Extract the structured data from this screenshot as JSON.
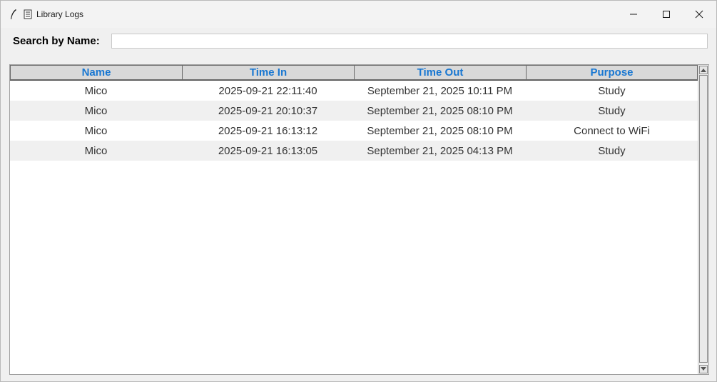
{
  "window": {
    "title": "Library Logs",
    "controls": {
      "minimize": "minimize-icon",
      "maximize": "maximize-icon",
      "close": "close-icon"
    }
  },
  "search": {
    "label": "Search by Name:",
    "value": "",
    "placeholder": ""
  },
  "table": {
    "columns": [
      "Name",
      "Time In",
      "Time Out",
      "Purpose"
    ],
    "header_color": "#1877d2",
    "rows": [
      [
        "Mico",
        "2025-09-21 22:11:40",
        "September 21, 2025 10:11 PM",
        "Study"
      ],
      [
        "Mico",
        "2025-09-21 20:10:37",
        "September 21, 2025 08:10 PM",
        "Study"
      ],
      [
        "Mico",
        "2025-09-21 16:13:12",
        "September 21, 2025 08:10 PM",
        "Connect to WiFi"
      ],
      [
        "Mico",
        "2025-09-21 16:13:05",
        "September 21, 2025 04:13 PM",
        "Study"
      ]
    ]
  }
}
